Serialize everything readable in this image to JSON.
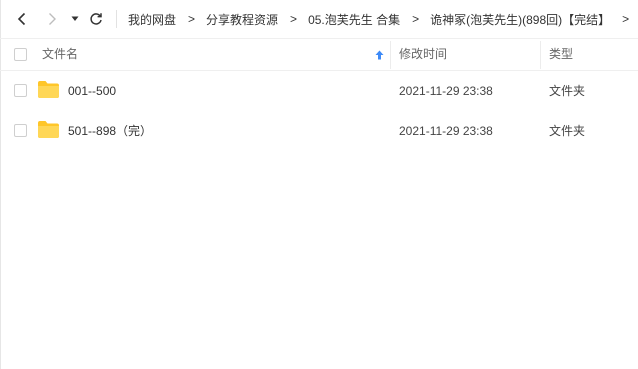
{
  "nav": {
    "back_icon": "chevron-left-icon",
    "forward_icon": "chevron-right-icon",
    "dropdown_icon": "triangle-down-icon",
    "refresh_icon": "refresh-icon",
    "breadcrumbs": [
      {
        "label": "我的网盘"
      },
      {
        "label": "分享教程资源"
      },
      {
        "label": "05.泡芙先生 合集"
      },
      {
        "label": "诡神冢(泡芙先生)(898回)【完结】"
      }
    ],
    "separator": ">"
  },
  "header": {
    "name_label": "文件名",
    "time_label": "修改时间",
    "type_label": "类型",
    "sort_icon": "sort-up-arrow-icon",
    "sort_color": "#3d8af7"
  },
  "files": [
    {
      "name": "001--500",
      "modified": "2021-11-29 23:38",
      "type": "文件夹"
    },
    {
      "name": "501--898（完）",
      "modified": "2021-11-29 23:38",
      "type": "文件夹"
    }
  ],
  "colors": {
    "folder": "#ffd24c",
    "folder_tab": "#ffc629"
  }
}
